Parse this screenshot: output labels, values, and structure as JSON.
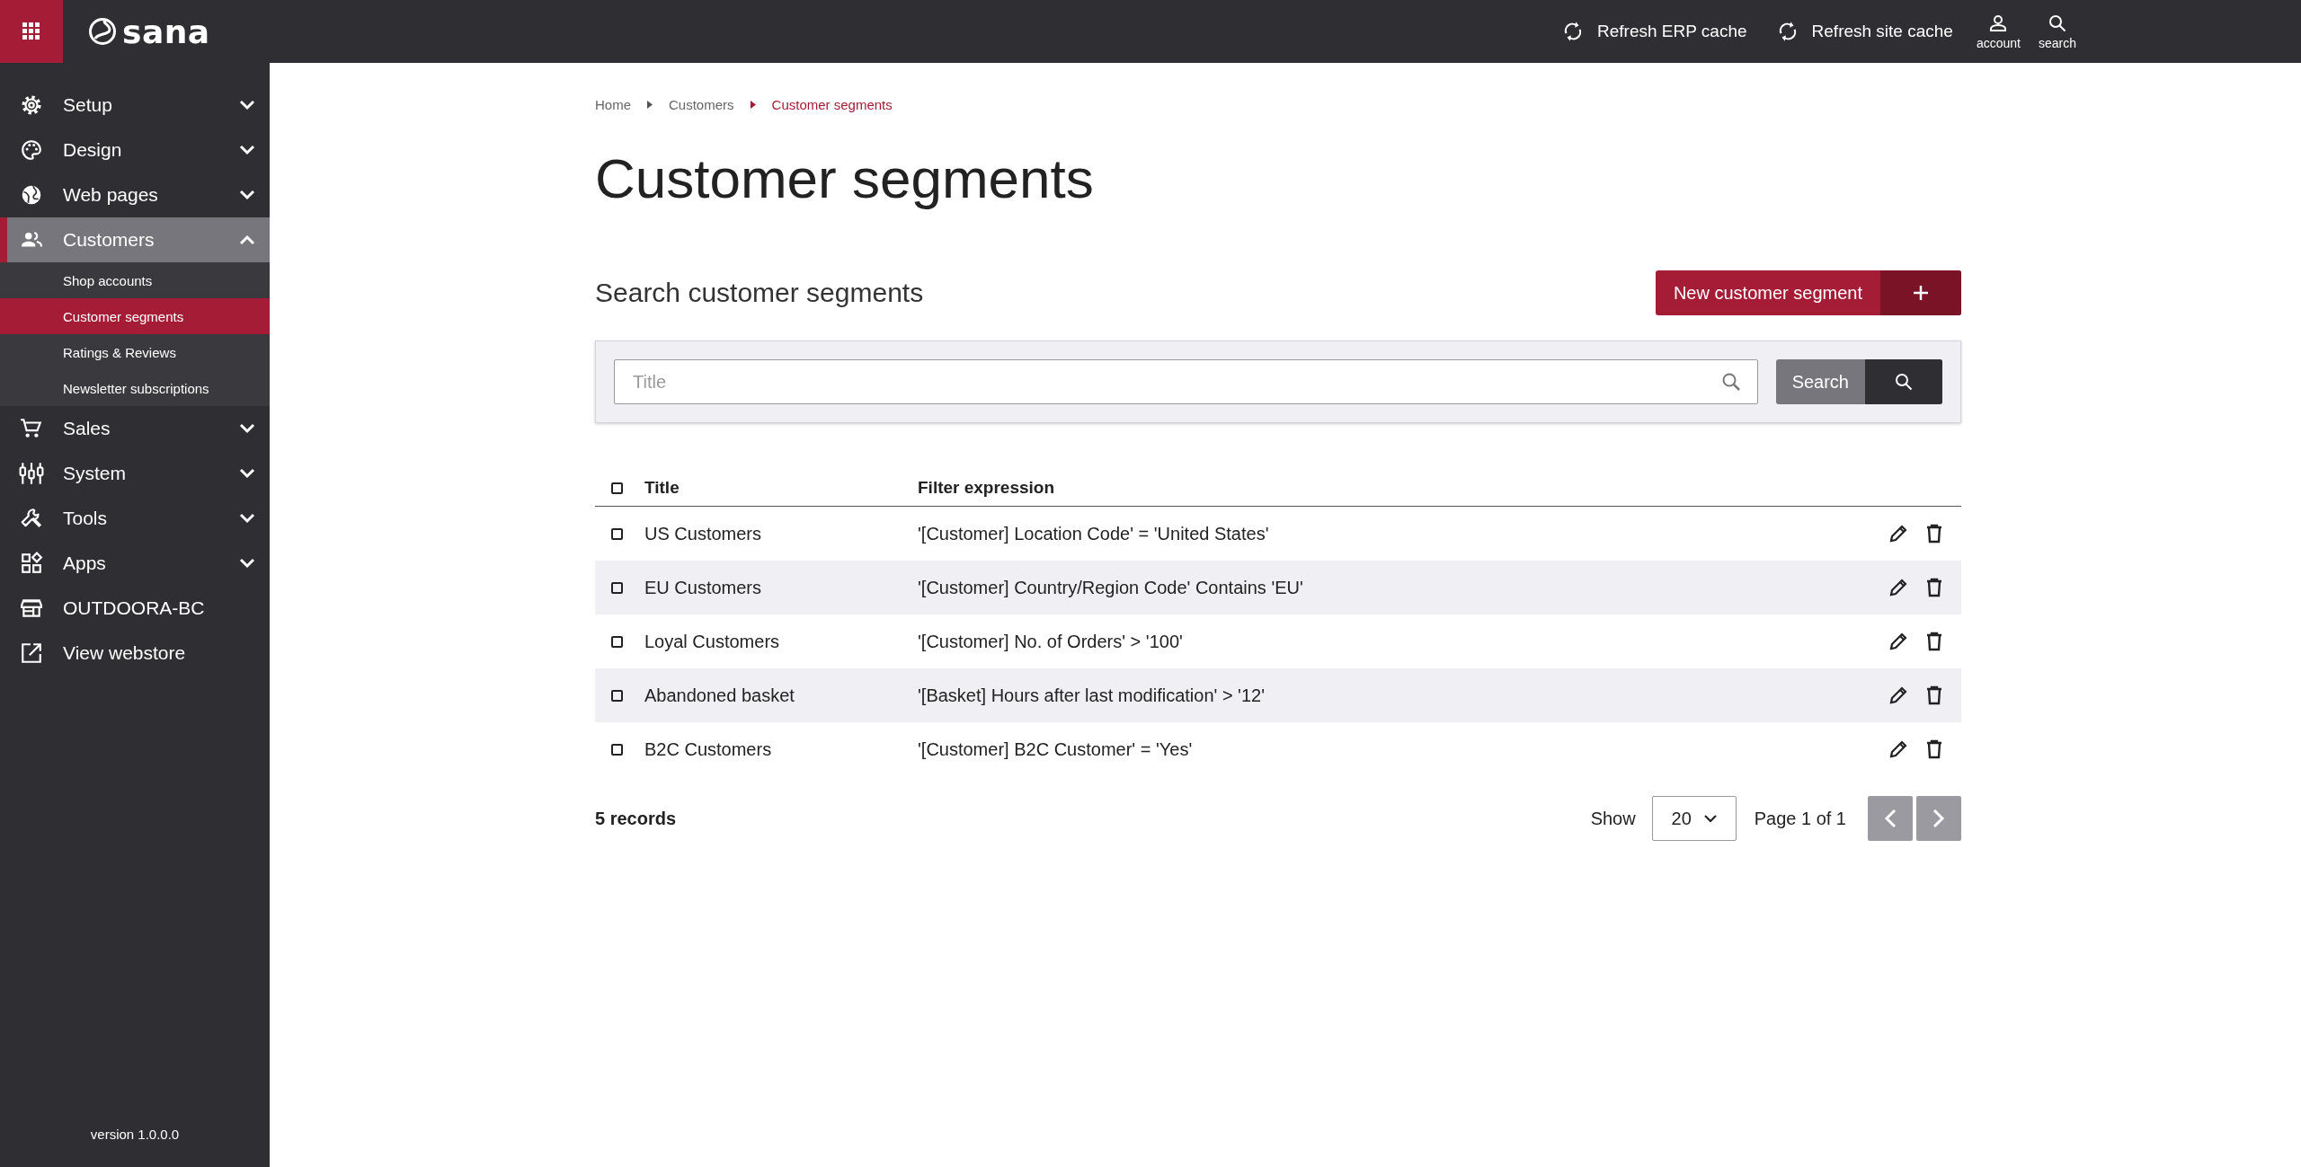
{
  "topbar": {
    "logo": "sana",
    "actions": [
      {
        "label": "Refresh ERP cache",
        "kind": "refresh"
      },
      {
        "label": "Refresh site cache",
        "kind": "refresh"
      }
    ],
    "tools": [
      {
        "label": "account",
        "kind": "account"
      },
      {
        "label": "search",
        "kind": "search"
      }
    ]
  },
  "sidebar": {
    "items": [
      {
        "label": "Setup",
        "kind": "group",
        "expanded": false,
        "selected": false
      },
      {
        "label": "Design",
        "kind": "group",
        "expanded": false,
        "selected": false
      },
      {
        "label": "Web pages",
        "kind": "group",
        "expanded": false,
        "selected": false
      },
      {
        "label": "Customers",
        "kind": "group",
        "expanded": true,
        "selected": true,
        "children": [
          {
            "label": "Shop accounts",
            "selected": false
          },
          {
            "label": "Customer segments",
            "selected": true
          },
          {
            "label": "Ratings & Reviews",
            "selected": false
          },
          {
            "label": "Newsletter subscriptions",
            "selected": false
          }
        ]
      },
      {
        "label": "Sales",
        "kind": "group",
        "expanded": false,
        "selected": false
      },
      {
        "label": "System",
        "kind": "group",
        "expanded": false,
        "selected": false
      },
      {
        "label": "Tools",
        "kind": "group",
        "expanded": false,
        "selected": false
      },
      {
        "label": "Apps",
        "kind": "group",
        "expanded": false,
        "selected": false
      },
      {
        "label": "OUTDOORA-BC",
        "kind": "link",
        "selected": false
      },
      {
        "label": "View webstore",
        "kind": "link",
        "selected": false
      }
    ],
    "version": "version 1.0.0.0"
  },
  "breadcrumb": [
    {
      "label": "Home",
      "selected": false
    },
    {
      "label": "Customers",
      "selected": false
    },
    {
      "label": "Customer segments",
      "selected": true
    }
  ],
  "title": "Customer segments",
  "search": {
    "heading": "Search customer segments",
    "new_button": "New customer segment",
    "placeholder": "Title",
    "button": "Search"
  },
  "table": {
    "header_checked": false,
    "columns": [
      "Title",
      "Filter expression"
    ],
    "rows": [
      {
        "title": "US Customers",
        "filter": "'[Customer] Location Code' = 'United States'",
        "checked": false
      },
      {
        "title": "EU Customers",
        "filter": "'[Customer] Country/Region Code' Contains 'EU'",
        "checked": false
      },
      {
        "title": "Loyal Customers",
        "filter": "'[Customer] No. of Orders' > '100'",
        "checked": false
      },
      {
        "title": "Abandoned basket",
        "filter": "'[Basket] Hours after last modification' > '12'",
        "checked": false
      },
      {
        "title": "B2C Customers",
        "filter": "'[Customer] B2C Customer' = 'Yes'",
        "checked": false
      }
    ]
  },
  "footer": {
    "records": "5 records",
    "show_label": "Show",
    "page_size": "20",
    "page": "Page 1 of 1",
    "prev_disabled": true,
    "next_disabled": true
  }
}
